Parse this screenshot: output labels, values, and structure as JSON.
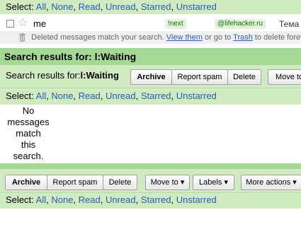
{
  "top_select": {
    "label": "Select:",
    "options": [
      "All",
      "None",
      "Read",
      "Unread",
      "Starred",
      "Unstarred"
    ]
  },
  "message": {
    "sender": "me",
    "labels": [
      {
        "text": "!next",
        "bg": "#d8f0c8"
      },
      {
        "text": "@lifehacker.ru",
        "bg": "#d8f0c8"
      }
    ],
    "subject": "Тема"
  },
  "notice": {
    "prefix": "Deleted messages match your search. ",
    "link1": "View them",
    "middle": " or go to ",
    "link2": "Trash",
    "suffix": " to delete forever"
  },
  "header": {
    "title": "Search results for: l:Waiting"
  },
  "top_toolbar": {
    "title_prefix": "Search results for:",
    "title_query": "l:Waiting",
    "archive": "Archive",
    "report_spam": "Report spam",
    "delete": "Delete",
    "move_to": "Move to"
  },
  "mid_select": {
    "label": "Select:",
    "options": [
      "All",
      "None",
      "Read",
      "Unread",
      "Starred",
      "Unstarred"
    ]
  },
  "empty_message": [
    "No",
    "messages",
    "match",
    "this",
    "search."
  ],
  "bottom_toolbar": {
    "archive": "Archive",
    "report_spam": "Report spam",
    "delete": "Delete",
    "move_to": "Move to ▾",
    "labels": "Labels ▾",
    "more_actions": "More actions ▾"
  },
  "bottom_select": {
    "label": "Select:",
    "options": [
      "All",
      "None",
      "Read",
      "Unread",
      "Starred",
      "Unstarred"
    ]
  },
  "colors": {
    "green_light": "#d0ebc2",
    "green_dark": "#a4d995",
    "link": "#2a5db0"
  }
}
